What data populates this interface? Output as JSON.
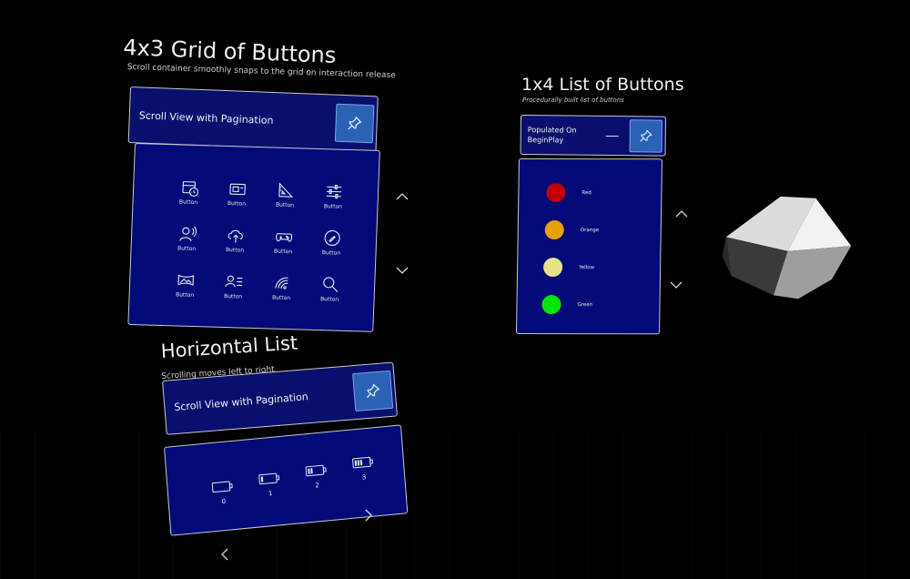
{
  "grid_section": {
    "title": "4x3 Grid of Buttons",
    "subtitle": "Scroll container smoothly snaps to the grid on interaction release",
    "header_label": "Scroll View with Pagination",
    "buttons": [
      {
        "label": "Button",
        "icon": "calendar-clock-icon"
      },
      {
        "label": "Button",
        "icon": "id-card-icon"
      },
      {
        "label": "Button",
        "icon": "ruler-triangle-icon"
      },
      {
        "label": "Button",
        "icon": "sliders-icon"
      },
      {
        "label": "Button",
        "icon": "person-voice-icon"
      },
      {
        "label": "Button",
        "icon": "cloud-upload-icon"
      },
      {
        "label": "Button",
        "icon": "gamepad-icon"
      },
      {
        "label": "Button",
        "icon": "pen-circle-icon"
      },
      {
        "label": "Button",
        "icon": "panorama-icon"
      },
      {
        "label": "Button",
        "icon": "person-list-icon"
      },
      {
        "label": "Button",
        "icon": "wifi-signal-icon"
      },
      {
        "label": "Button",
        "icon": "search-icon"
      }
    ]
  },
  "horizontal_section": {
    "title": "Horizontal List",
    "subtitle": "Scrolling moves left to right",
    "header_label": "Scroll View with Pagination",
    "items": [
      {
        "label": "0",
        "icon": "battery-empty-icon",
        "level": 0
      },
      {
        "label": "1",
        "icon": "battery-low-icon",
        "level": 1
      },
      {
        "label": "2",
        "icon": "battery-mid-icon",
        "level": 2
      },
      {
        "label": "3",
        "icon": "battery-high-icon",
        "level": 3
      }
    ]
  },
  "list_section": {
    "title": "1x4 List of Buttons",
    "subtitle": "Procedurally built list of buttons",
    "header_label_line1": "Populated On",
    "header_label_line2": "BeginPlay",
    "items": [
      {
        "label": "Red",
        "color": "#c00000"
      },
      {
        "label": "Orange",
        "color": "#e8a200"
      },
      {
        "label": "Yellow",
        "color": "#e8e38a"
      },
      {
        "label": "Green",
        "color": "#00e600"
      }
    ]
  },
  "colors": {
    "panel": "#010a78",
    "pin_button": "#2b62b5"
  }
}
